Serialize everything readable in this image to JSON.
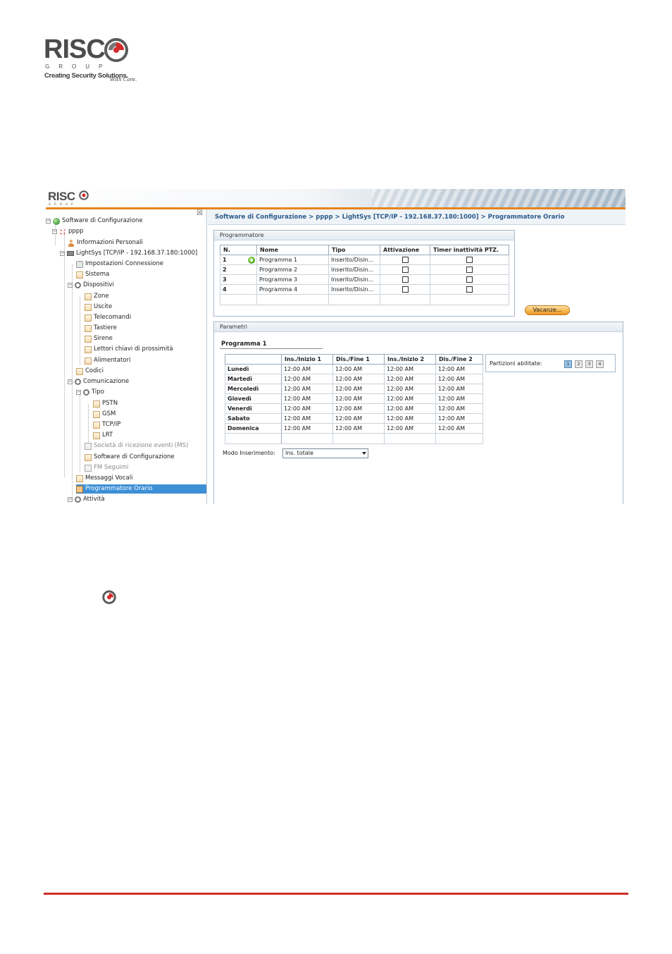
{
  "page_logo": {
    "wordmark": "RISC",
    "group": "GROUP",
    "tagline": "Creating Security Solutions.",
    "tagline_care": "With Care."
  },
  "app": {
    "header_logo": "RISC",
    "header_group": "GROUP",
    "close_glyph": "☒",
    "breadcrumb": "Software di Configurazione > pppp > LightSys [TCP/IP - 192.168.37.180:1000] > Programmatore Orario",
    "tree": [
      {
        "label": "Software di Configurazione",
        "icon": "globe-icon"
      },
      {
        "label": "pppp",
        "icon": "network-icon"
      },
      {
        "label": "Informazioni Personali",
        "icon": "person-icon"
      },
      {
        "label": "LightSys [TCP/IP - 192.168.37.180:1000]",
        "icon": "panel-icon"
      },
      {
        "label": "Impostazioni Connessione",
        "icon": "plug-icon"
      },
      {
        "label": "Sistema",
        "icon": "folder-icon"
      },
      {
        "label": "Dispositivi",
        "icon": "gear-icon"
      },
      {
        "label": "Zone",
        "icon": "folder-icon"
      },
      {
        "label": "Uscite",
        "icon": "folder-icon"
      },
      {
        "label": "Telecomandi",
        "icon": "folder-icon"
      },
      {
        "label": "Tastiere",
        "icon": "folder-icon"
      },
      {
        "label": "Sirene",
        "icon": "folder-icon"
      },
      {
        "label": "Lettori chiavi di prossimità",
        "icon": "folder-icon"
      },
      {
        "label": "Alimentatori",
        "icon": "folder-icon"
      },
      {
        "label": "Codici",
        "icon": "folder-icon"
      },
      {
        "label": "Comunicazione",
        "icon": "gear-icon"
      },
      {
        "label": "Tipo",
        "icon": "gear-icon"
      },
      {
        "label": "PSTN",
        "icon": "folder-icon"
      },
      {
        "label": "GSM",
        "icon": "folder-icon"
      },
      {
        "label": "TCP/IP",
        "icon": "folder-icon"
      },
      {
        "label": "LRT",
        "icon": "folder-icon"
      },
      {
        "label": "Società di ricezione eventi (MS)",
        "icon": "folder-icon",
        "disabled": true
      },
      {
        "label": "Software di Configurazione",
        "icon": "folder-icon"
      },
      {
        "label": "FM Seguimi",
        "icon": "folder-icon",
        "disabled": true
      },
      {
        "label": "Messaggi Vocali",
        "icon": "folder-icon"
      },
      {
        "label": "Programmatore Orario",
        "icon": "schedule-icon",
        "selected": true
      },
      {
        "label": "Attività",
        "icon": "gear-icon"
      }
    ],
    "programmatore": {
      "title": "Programmatore",
      "columns": [
        "N.",
        "Nome",
        "Tipo",
        "Attivazione",
        "Timer inattività PTZ."
      ],
      "rows": [
        {
          "n": "1",
          "nome": "Programma 1",
          "tipo": "Inserito/Disin...",
          "current": true
        },
        {
          "n": "2",
          "nome": "Programma 2",
          "tipo": "Inserito/Disin..."
        },
        {
          "n": "3",
          "nome": "Programma 3",
          "tipo": "Inserito/Disin..."
        },
        {
          "n": "4",
          "nome": "Programma 4",
          "tipo": "Inserito/Disin..."
        }
      ],
      "vacanze_label": "Vacanze..."
    },
    "parametri": {
      "title": "Parametri",
      "program_title": "Programma 1",
      "columns": [
        "",
        "Ins./Inizio 1",
        "Dis./Fine 1",
        "Ins./Inizio 2",
        "Dis./Fine 2"
      ],
      "rows": [
        {
          "day": "Lunedì",
          "v": [
            "12:00 AM",
            "12:00 AM",
            "12:00 AM",
            "12:00 AM"
          ]
        },
        {
          "day": "Martedì",
          "v": [
            "12:00 AM",
            "12:00 AM",
            "12:00 AM",
            "12:00 AM"
          ]
        },
        {
          "day": "Mercoledì",
          "v": [
            "12:00 AM",
            "12:00 AM",
            "12:00 AM",
            "12:00 AM"
          ]
        },
        {
          "day": "Giovedì",
          "v": [
            "12:00 AM",
            "12:00 AM",
            "12:00 AM",
            "12:00 AM"
          ]
        },
        {
          "day": "Venerdì",
          "v": [
            "12:00 AM",
            "12:00 AM",
            "12:00 AM",
            "12:00 AM"
          ]
        },
        {
          "day": "Sabato",
          "v": [
            "12:00 AM",
            "12:00 AM",
            "12:00 AM",
            "12:00 AM"
          ]
        },
        {
          "day": "Domenica",
          "v": [
            "12:00 AM",
            "12:00 AM",
            "12:00 AM",
            "12:00 AM"
          ]
        }
      ],
      "partizioni_label": "Partizioni abilitate:",
      "partizioni": [
        "1",
        "2",
        "3",
        "4"
      ],
      "modo_label": "Modo Inserimento:",
      "modo_value": "Ins. totale"
    }
  },
  "colors": {
    "accent_orange": "#e8821e",
    "footer_red": "#d12d2d",
    "selection_blue": "#3d8fd6",
    "breadcrumb_text": "#2a5a8a"
  }
}
